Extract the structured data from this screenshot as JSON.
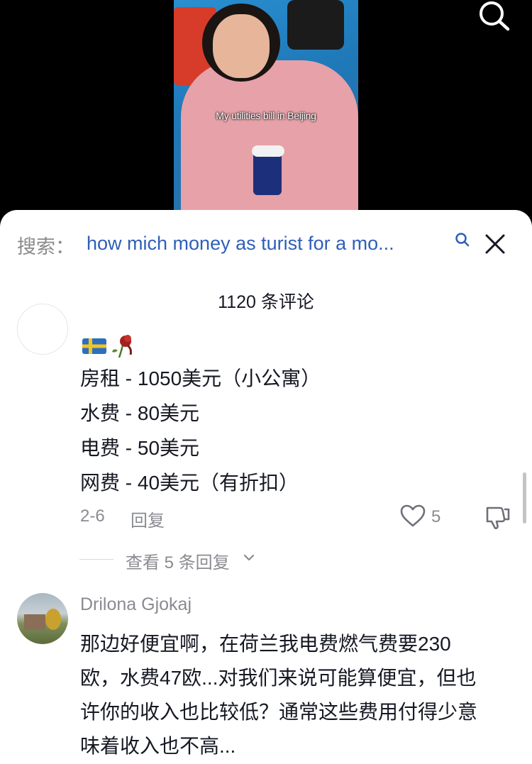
{
  "video": {
    "caption": "My utilities bill in Beijing"
  },
  "top_bar": {
    "search_icon": "search-icon"
  },
  "search": {
    "prefix": "搜索：",
    "query": "how mich money as turist for a mo...",
    "query_icon": "search-icon",
    "close_icon": "close-icon"
  },
  "comments_header": {
    "count_text": "1120 条评论"
  },
  "comment1": {
    "emoji": "flag-sweden, wilted-rose",
    "lines": [
      "房租 - 1050美元（小公寓）",
      "水费 - 80美元",
      "电费 - 50美元",
      "网费 - 40美元（有折扣）"
    ],
    "date": "2-6",
    "reply_label": "回复",
    "like_count": "5",
    "view_replies": "查看 5 条回复"
  },
  "comment2": {
    "username": "Drilona Gjokaj",
    "lines": [
      "那边好便宜啊，在荷兰我电费燃气费要230",
      "欧，水费47欧...对我们来说可能算便宜，但也",
      "许你的收入也比较低？通常这些费用付得少意",
      "味着收入也不高..."
    ]
  },
  "colors": {
    "link_blue": "#2f5fb8",
    "text_dark": "#161823",
    "text_gray": "#8a8b91"
  }
}
